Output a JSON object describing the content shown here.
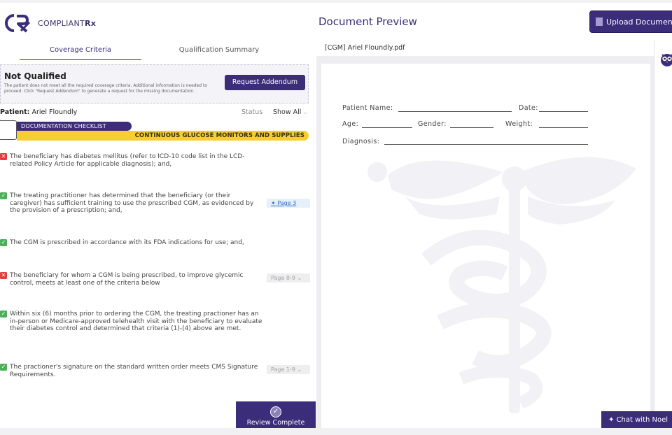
{
  "brand": {
    "name_prefix": "COMPLIANT",
    "name_suffix": "Rx"
  },
  "tabs": [
    {
      "label": "Coverage Criteria",
      "active": true
    },
    {
      "label": "Qualification Summary",
      "active": false
    }
  ],
  "status": {
    "title": "Not Qualified",
    "description": "The patient does not meet all the required coverage criteria. Additional information is needed to proceed. Click \"Request Addendum\" to generate a request for the missing documentation.",
    "button_label": "Request Addendum"
  },
  "patient": {
    "prefix": "Patient:",
    "name": "Ariel Floundly"
  },
  "filter": {
    "status_label": "Status",
    "value": "Show All"
  },
  "checklist": {
    "banner": "DOCUMENTATION CHECKLIST",
    "category": "CONTINUOUS GLUCOSE MONITORS AND SUPPLIES",
    "items": [
      {
        "status": "fail",
        "text": "The beneficiary has diabetes mellitus (refer to ICD-10 code list in the LCD-related Policy Article for applicable diagnosis); and,",
        "page": ""
      },
      {
        "status": "pass",
        "text": "The treating practitioner has determined that the beneficiary (or their caregiver) has sufficient training to use the prescribed CGM, as evidenced by the provision of a prescription; and,",
        "page": "Page 3"
      },
      {
        "status": "pass",
        "text": "The CGM is prescribed in accordance with its FDA indications for use; and,",
        "page": ""
      },
      {
        "status": "fail",
        "text": "The beneficiary for whom a CGM is being prescribed, to improve glycemic control, meets at least one of the criteria below",
        "page": "Page 8-9"
      },
      {
        "status": "pass",
        "text": "Within six (6) months prior to ordering the CGM, the treating practioner has an in-person or Medicare-approved telehealth visit with the beneficiary to evaluate their diabetes control and determined that criteria (1)-(4) above are met.",
        "page": ""
      },
      {
        "status": "pass",
        "text": "The practioner's signature on the standard written order meets CMS Signature Requirements.",
        "page": "Page 1-9"
      }
    ]
  },
  "review_button": "Review Complete",
  "preview": {
    "title": "Document Preview",
    "upload_label": "Upload Document",
    "filename": "[CGM] Ariel Floundly.pdf",
    "fields": {
      "patient_name": "Patient Name:",
      "date": "Date:",
      "age": "Age:",
      "gender": "Gender:",
      "weight": "Weight:",
      "diagnosis": "Diagnosis:"
    }
  },
  "chat_button": "Chat with Noel",
  "colors": {
    "primary": "#3b2d7a",
    "accent": "#f6cf2e",
    "pass": "#4cb05a",
    "fail": "#e03e3e"
  }
}
